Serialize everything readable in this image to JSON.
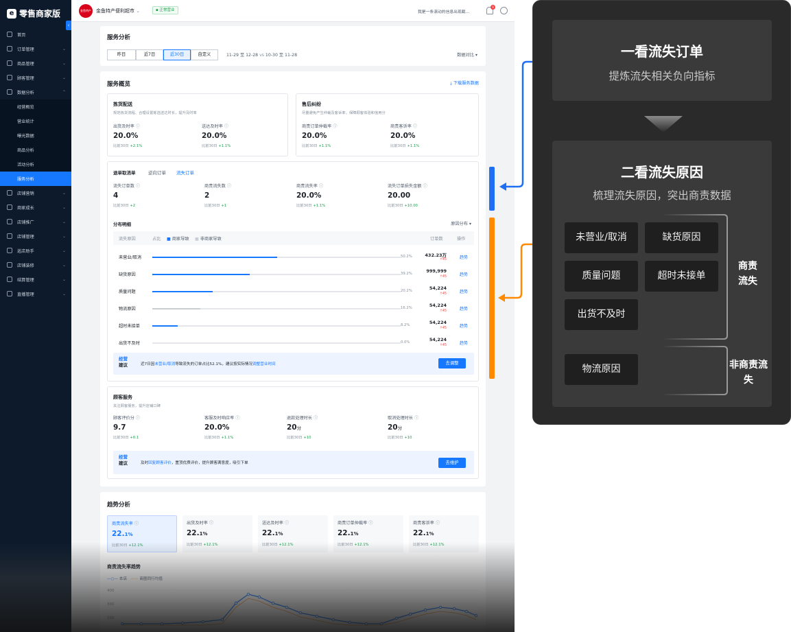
{
  "app": {
    "brand": "零售商家版",
    "logo_glyph": "e"
  },
  "sidebar": {
    "items": [
      {
        "label": "首页",
        "type": "main"
      },
      {
        "label": "订单管理",
        "type": "main",
        "chevron": "⌄"
      },
      {
        "label": "商品管理",
        "type": "main",
        "chevron": "⌄"
      },
      {
        "label": "顾客管理",
        "type": "main",
        "chevron": "⌄"
      },
      {
        "label": "数据分析",
        "type": "main",
        "chevron": "⌃"
      },
      {
        "label": "经营概览",
        "type": "sub"
      },
      {
        "label": "营业统计",
        "type": "sub"
      },
      {
        "label": "曝光数据",
        "type": "sub"
      },
      {
        "label": "商品分析",
        "type": "sub"
      },
      {
        "label": "活动分析",
        "type": "sub"
      },
      {
        "label": "服务分析",
        "type": "active"
      },
      {
        "label": "店铺营销",
        "type": "main",
        "chevron": "⌄"
      },
      {
        "label": "商家成长",
        "type": "main",
        "chevron": "⌄"
      },
      {
        "label": "店铺推广",
        "type": "main",
        "chevron": "⌄"
      },
      {
        "label": "店铺管理",
        "type": "main",
        "chevron": "⌄"
      },
      {
        "label": "巡店助手",
        "type": "main",
        "chevron": "⌄"
      },
      {
        "label": "店铺装修",
        "type": "main",
        "chevron": "⌄"
      },
      {
        "label": "结算管理",
        "type": "main",
        "chevron": "⌄"
      },
      {
        "label": "直播管理",
        "type": "main",
        "chevron": "⌄"
      }
    ]
  },
  "topbar": {
    "store_logo": "金鱼特产",
    "store_name": "金鱼特产便利超市",
    "store_chevron": "⌄",
    "status": "正常营业",
    "notice": "我是一条滚动的信息出现截...",
    "bell_count": "9"
  },
  "analysis": {
    "title": "服务分析",
    "periods": [
      "昨日",
      "近7日",
      "近30日",
      "自定义"
    ],
    "selected_period": "近30日",
    "range_current": "11-29 至 12-28",
    "vs": "vs",
    "range_compare": "10-30 至 11-28",
    "compare_label": "数据对比",
    "compare_chevron": "▾"
  },
  "overview": {
    "title": "服务概览",
    "download": "下载服务数据",
    "download_icon": "⤓",
    "picking": {
      "title": "拣货配送",
      "desc": "规范拣货流程、合理设置拣选送达时长，提升及时率",
      "metrics": [
        {
          "label": "出货及时率",
          "value": "20.0%",
          "cmp": "比前30日",
          "delta": "+2.1%"
        },
        {
          "label": "送达及时率",
          "value": "20.0%",
          "cmp": "比前30日",
          "delta": "+1.1%"
        }
      ]
    },
    "aftersale": {
      "title": "售后纠纷",
      "desc": "尽量避免产生仲裁及客诉率，保障顾客体验和信用分",
      "metrics": [
        {
          "label": "商责订单仲裁率",
          "value": "20.0%",
          "cmp": "比前30日",
          "delta": "+1.1%"
        },
        {
          "label": "商责客诉率",
          "value": "20.0%",
          "cmp": "比前30日",
          "delta": "+1.1%"
        }
      ]
    },
    "refund": {
      "tabs": [
        "退单取消单",
        "逆向订单",
        "流失订单"
      ],
      "active_tab": "流失订单",
      "metrics": [
        {
          "label": "流失订单数",
          "value": "4",
          "cmp": "比前30日",
          "delta": "+2"
        },
        {
          "label": "商责流失数",
          "value": "2",
          "cmp": "比前30日",
          "delta": "+1"
        },
        {
          "label": "商责流失率",
          "value": "20.0%",
          "cmp": "比前30日",
          "delta": "+1.1%"
        },
        {
          "label": "流失订单损失金额",
          "value": "20.00",
          "cmp": "比前30日",
          "delta": "+10.00"
        }
      ],
      "dist_title": "分布明细",
      "dist_filter": "原因分布",
      "dist_filter_chevron": "▾",
      "columns": {
        "reason": "流失原因",
        "share": "占比",
        "merchant": "商家导致",
        "nonmerchant": "非商家导致",
        "orders": "订单数",
        "action": "操作"
      },
      "rows": [
        {
          "reason": "未营业/取消",
          "share": 0.502,
          "share_label": "50.2%",
          "orders": "432.23万",
          "delta": "↑45",
          "action": "趋势",
          "merchant": true
        },
        {
          "reason": "缺货原因",
          "share": 0.392,
          "share_label": "39.2%",
          "orders": "999,999",
          "delta": "↑45",
          "action": "趋势",
          "merchant": true
        },
        {
          "reason": "质量问题",
          "share": 0.242,
          "share_label": "20.2%",
          "orders": "54,224",
          "delta": "↑45",
          "action": "趋势",
          "merchant": true
        },
        {
          "reason": "物流原因",
          "share": 0.192,
          "share_label": "16.2%",
          "orders": "54,224",
          "delta": "↑45",
          "action": "趋势",
          "merchant": false
        },
        {
          "reason": "超时未接单",
          "share": 0.102,
          "share_label": "8.2%",
          "orders": "54,224",
          "delta": "↑45",
          "action": "趋势",
          "merchant": true
        },
        {
          "reason": "出货不及时",
          "share": 0,
          "share_label": "0.0%",
          "orders": "54,224",
          "delta": "↑45",
          "action": "趋势",
          "merchant": true
        }
      ],
      "advice": {
        "tag1": "经营",
        "tag2": "建议",
        "pre": "近7日因",
        "link1": "未营业/取消",
        "mid": "导致流失的订单占比52.1%，建议按实际情况",
        "link2": "调整营业时间",
        "button": "去调整"
      }
    },
    "customer": {
      "title": "顾客服务",
      "desc": "关注顾客服务，提升店铺口碑",
      "metrics": [
        {
          "label": "顾客评价分",
          "value": "9.7",
          "unit": "",
          "cmp": "比前30日",
          "delta": "+0.1"
        },
        {
          "label": "客服及时响应率",
          "value": "20.0%",
          "unit": "",
          "cmp": "比前30日",
          "delta": "+1.1%"
        },
        {
          "label": "退款处理时长",
          "value": "20",
          "unit": "分",
          "cmp": "比前30日",
          "delta": "+10"
        },
        {
          "label": "取消处理时长",
          "value": "20",
          "unit": "分",
          "cmp": "比前30日",
          "delta": "+10"
        }
      ],
      "advice": {
        "tag1": "经营",
        "tag2": "建议",
        "pre": "及时",
        "link1": "回复顾客评价",
        "post": "，置顶优质评价，提升顾客满意度，吸引下单",
        "button": "去维护"
      }
    }
  },
  "trend": {
    "title": "趋势分析",
    "cards": [
      {
        "label": "商责流失率",
        "value": "22.",
        "small": "1%",
        "cmp": "比前30日",
        "delta": "+12.1%",
        "active": true
      },
      {
        "label": "出货及时率",
        "value": "22.",
        "small": "1%",
        "cmp": "比前30日",
        "delta": "+12.1%",
        "active": false
      },
      {
        "label": "送达及时率",
        "value": "22.",
        "small": "1%",
        "cmp": "比前30日",
        "delta": "+12.1%",
        "active": false
      },
      {
        "label": "商责订单仲裁率",
        "value": "22.",
        "small": "1%",
        "cmp": "比前30日",
        "delta": "+12.1%",
        "active": false
      },
      {
        "label": "商责客诉率",
        "value": "22.",
        "small": "1%",
        "cmp": "比前30日",
        "delta": "+12.1%",
        "active": false
      }
    ],
    "chart_title": "商责流失率趋势",
    "legend": [
      "本店",
      "商圈同行均值"
    ],
    "y_ticks": [
      "400",
      "300",
      "200"
    ]
  },
  "colors": {
    "accent": "#1677ff",
    "series_store": "#1677ff",
    "series_peer": "#ff9a3c",
    "callout_blue": "#1f6ff2",
    "callout_orange": "#ff8a00",
    "up": "#1a9e4b",
    "down": "#f53f3f"
  },
  "annotation": {
    "first": {
      "title": "一看流失订单",
      "subtitle": "提炼流失相关负向指标"
    },
    "second": {
      "title": "二看流失原因",
      "subtitle": "梳理流失原因，突出商责数据"
    },
    "merchant_reasons": [
      "未营业/取消",
      "缺货原因",
      "质量问题",
      "超时未接单",
      "出货不及时"
    ],
    "merchant_label": "商责流失",
    "nonmerchant_reasons": [
      "物流原因"
    ],
    "nonmerchant_label": "非商责流失"
  }
}
